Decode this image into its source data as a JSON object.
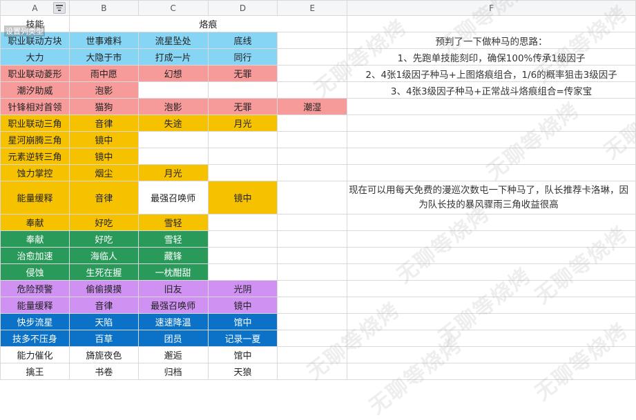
{
  "columns": [
    "A",
    "B",
    "C",
    "D",
    "E",
    "F"
  ],
  "tooltip": "设置列类型",
  "header_row": {
    "a": "技能",
    "merged": "烙痕"
  },
  "rows": [
    {
      "cells": [
        "职业联动方块",
        "世事难料",
        "流星坠处",
        "底线",
        ""
      ],
      "fills": [
        "blue",
        "blue",
        "blue",
        "blue",
        "white"
      ],
      "note": "预判了一下做种马的思路："
    },
    {
      "cells": [
        "大力",
        "大隐于市",
        "打成一片",
        "同行",
        ""
      ],
      "fills": [
        "blue",
        "blue",
        "blue",
        "blue",
        "white"
      ],
      "note": "1、先跑单技能刻印，确保100%传承1级因子"
    },
    {
      "cells": [
        "职业联动菱形",
        "雨中愿",
        "幻想",
        "无罪",
        ""
      ],
      "fills": [
        "red",
        "red",
        "red",
        "red",
        "white"
      ],
      "note": "2、4张1级因子种马+上图烙痕组合，1/6的概率狙击3级因子"
    },
    {
      "cells": [
        "潮汐助威",
        "泡影",
        "",
        "",
        ""
      ],
      "fills": [
        "red",
        "red",
        "white",
        "white",
        "white"
      ],
      "note": "3、4张3级因子种马+正常战斗烙痕组合=传家宝"
    },
    {
      "cells": [
        "针锋相对首领",
        "猫狗",
        "泡影",
        "无罪",
        "潮湿"
      ],
      "fills": [
        "red",
        "red",
        "red",
        "red",
        "red"
      ],
      "note": ""
    },
    {
      "cells": [
        "职业联动三角",
        "音律",
        "失途",
        "月光",
        ""
      ],
      "fills": [
        "yellow",
        "yellow",
        "yellow",
        "yellow",
        "white"
      ],
      "note": ""
    },
    {
      "cells": [
        "星河崩腾三角",
        "镜中",
        "",
        "",
        ""
      ],
      "fills": [
        "yellow",
        "yellow",
        "white",
        "white",
        "white"
      ],
      "note": ""
    },
    {
      "cells": [
        "元素逆转三角",
        "镜中",
        "",
        "",
        ""
      ],
      "fills": [
        "yellow",
        "yellow",
        "white",
        "white",
        "white"
      ],
      "note": ""
    },
    {
      "cells": [
        "蚀力掌控",
        "烟尘",
        "月光",
        "",
        ""
      ],
      "fills": [
        "yellow",
        "yellow",
        "yellow",
        "white",
        "white"
      ],
      "note": ""
    },
    {
      "cells": [
        "能量缓释",
        "音律",
        "最强召唤师",
        "镜中",
        ""
      ],
      "fills": [
        "yellow",
        "yellow",
        "white",
        "yellow",
        "white"
      ],
      "note": "现在可以用每天免费的漫巡次数屯一下种马了，队长推荐卡洛琳，因为队长技的暴风骤雨三角收益很高",
      "tall": true
    },
    {
      "cells": [
        "奉献",
        "好吃",
        "雪轻",
        "",
        ""
      ],
      "fills": [
        "yellow",
        "yellow",
        "yellow",
        "white",
        "white"
      ],
      "note": ""
    },
    {
      "cells": [
        "奉献",
        "好吃",
        "雪轻",
        "",
        ""
      ],
      "fills": [
        "green",
        "green",
        "green",
        "white",
        "white"
      ],
      "note": ""
    },
    {
      "cells": [
        "治愈加速",
        "海临人",
        "藏锋",
        "",
        ""
      ],
      "fills": [
        "green",
        "green",
        "green",
        "white",
        "white"
      ],
      "note": ""
    },
    {
      "cells": [
        "侵蚀",
        "生死在握",
        "一枕酣甜",
        "",
        ""
      ],
      "fills": [
        "green",
        "green",
        "green",
        "white",
        "white"
      ],
      "note": ""
    },
    {
      "cells": [
        "危险预警",
        "偷偷摸摸",
        "旧友",
        "光阴",
        ""
      ],
      "fills": [
        "purple",
        "purple",
        "purple",
        "purple",
        "white"
      ],
      "note": ""
    },
    {
      "cells": [
        "能量缓释",
        "音律",
        "最强召唤师",
        "镜中",
        ""
      ],
      "fills": [
        "purple",
        "purple",
        "purple",
        "purple",
        "white"
      ],
      "note": ""
    },
    {
      "cells": [
        "快步流星",
        "天陷",
        "速速降温",
        "馆中",
        ""
      ],
      "fills": [
        "dblue",
        "dblue",
        "dblue",
        "dblue",
        "white"
      ],
      "note": ""
    },
    {
      "cells": [
        "技多不压身",
        "百草",
        "团员",
        "记录一夏",
        ""
      ],
      "fills": [
        "dblue",
        "dblue",
        "dblue",
        "dblue",
        "white"
      ],
      "note": ""
    },
    {
      "cells": [
        "能力催化",
        "旖旎夜色",
        "邂逅",
        "馆中",
        ""
      ],
      "fills": [
        "white",
        "white",
        "white",
        "white",
        "white"
      ],
      "note": ""
    },
    {
      "cells": [
        "擒王",
        "书卷",
        "归档",
        "天狼",
        ""
      ],
      "fills": [
        "white",
        "white",
        "white",
        "white",
        "white"
      ],
      "note": ""
    }
  ],
  "watermark_text": "无聊等烧烤"
}
